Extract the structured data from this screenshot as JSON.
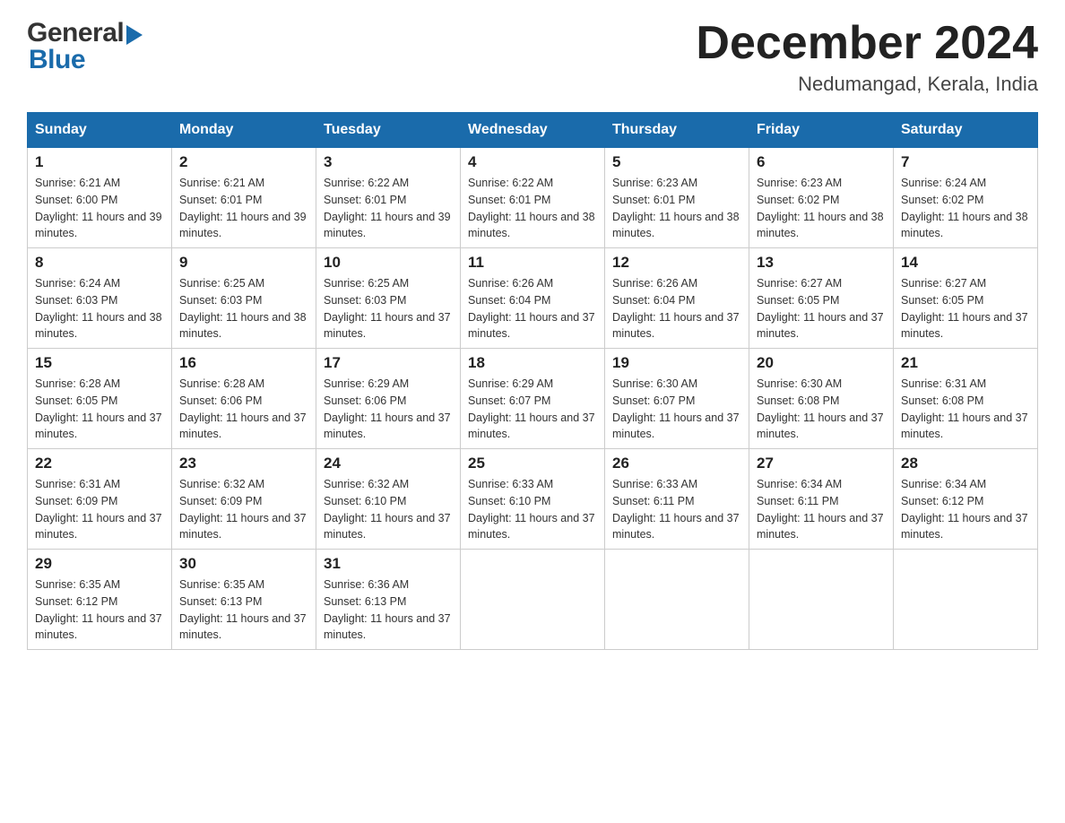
{
  "header": {
    "month_title": "December 2024",
    "location": "Nedumangad, Kerala, India"
  },
  "days_of_week": [
    "Sunday",
    "Monday",
    "Tuesday",
    "Wednesday",
    "Thursday",
    "Friday",
    "Saturday"
  ],
  "weeks": [
    [
      {
        "day": "1",
        "sunrise": "6:21 AM",
        "sunset": "6:00 PM",
        "daylight": "11 hours and 39 minutes."
      },
      {
        "day": "2",
        "sunrise": "6:21 AM",
        "sunset": "6:01 PM",
        "daylight": "11 hours and 39 minutes."
      },
      {
        "day": "3",
        "sunrise": "6:22 AM",
        "sunset": "6:01 PM",
        "daylight": "11 hours and 39 minutes."
      },
      {
        "day": "4",
        "sunrise": "6:22 AM",
        "sunset": "6:01 PM",
        "daylight": "11 hours and 38 minutes."
      },
      {
        "day": "5",
        "sunrise": "6:23 AM",
        "sunset": "6:01 PM",
        "daylight": "11 hours and 38 minutes."
      },
      {
        "day": "6",
        "sunrise": "6:23 AM",
        "sunset": "6:02 PM",
        "daylight": "11 hours and 38 minutes."
      },
      {
        "day": "7",
        "sunrise": "6:24 AM",
        "sunset": "6:02 PM",
        "daylight": "11 hours and 38 minutes."
      }
    ],
    [
      {
        "day": "8",
        "sunrise": "6:24 AM",
        "sunset": "6:03 PM",
        "daylight": "11 hours and 38 minutes."
      },
      {
        "day": "9",
        "sunrise": "6:25 AM",
        "sunset": "6:03 PM",
        "daylight": "11 hours and 38 minutes."
      },
      {
        "day": "10",
        "sunrise": "6:25 AM",
        "sunset": "6:03 PM",
        "daylight": "11 hours and 37 minutes."
      },
      {
        "day": "11",
        "sunrise": "6:26 AM",
        "sunset": "6:04 PM",
        "daylight": "11 hours and 37 minutes."
      },
      {
        "day": "12",
        "sunrise": "6:26 AM",
        "sunset": "6:04 PM",
        "daylight": "11 hours and 37 minutes."
      },
      {
        "day": "13",
        "sunrise": "6:27 AM",
        "sunset": "6:05 PM",
        "daylight": "11 hours and 37 minutes."
      },
      {
        "day": "14",
        "sunrise": "6:27 AM",
        "sunset": "6:05 PM",
        "daylight": "11 hours and 37 minutes."
      }
    ],
    [
      {
        "day": "15",
        "sunrise": "6:28 AM",
        "sunset": "6:05 PM",
        "daylight": "11 hours and 37 minutes."
      },
      {
        "day": "16",
        "sunrise": "6:28 AM",
        "sunset": "6:06 PM",
        "daylight": "11 hours and 37 minutes."
      },
      {
        "day": "17",
        "sunrise": "6:29 AM",
        "sunset": "6:06 PM",
        "daylight": "11 hours and 37 minutes."
      },
      {
        "day": "18",
        "sunrise": "6:29 AM",
        "sunset": "6:07 PM",
        "daylight": "11 hours and 37 minutes."
      },
      {
        "day": "19",
        "sunrise": "6:30 AM",
        "sunset": "6:07 PM",
        "daylight": "11 hours and 37 minutes."
      },
      {
        "day": "20",
        "sunrise": "6:30 AM",
        "sunset": "6:08 PM",
        "daylight": "11 hours and 37 minutes."
      },
      {
        "day": "21",
        "sunrise": "6:31 AM",
        "sunset": "6:08 PM",
        "daylight": "11 hours and 37 minutes."
      }
    ],
    [
      {
        "day": "22",
        "sunrise": "6:31 AM",
        "sunset": "6:09 PM",
        "daylight": "11 hours and 37 minutes."
      },
      {
        "day": "23",
        "sunrise": "6:32 AM",
        "sunset": "6:09 PM",
        "daylight": "11 hours and 37 minutes."
      },
      {
        "day": "24",
        "sunrise": "6:32 AM",
        "sunset": "6:10 PM",
        "daylight": "11 hours and 37 minutes."
      },
      {
        "day": "25",
        "sunrise": "6:33 AM",
        "sunset": "6:10 PM",
        "daylight": "11 hours and 37 minutes."
      },
      {
        "day": "26",
        "sunrise": "6:33 AM",
        "sunset": "6:11 PM",
        "daylight": "11 hours and 37 minutes."
      },
      {
        "day": "27",
        "sunrise": "6:34 AM",
        "sunset": "6:11 PM",
        "daylight": "11 hours and 37 minutes."
      },
      {
        "day": "28",
        "sunrise": "6:34 AM",
        "sunset": "6:12 PM",
        "daylight": "11 hours and 37 minutes."
      }
    ],
    [
      {
        "day": "29",
        "sunrise": "6:35 AM",
        "sunset": "6:12 PM",
        "daylight": "11 hours and 37 minutes."
      },
      {
        "day": "30",
        "sunrise": "6:35 AM",
        "sunset": "6:13 PM",
        "daylight": "11 hours and 37 minutes."
      },
      {
        "day": "31",
        "sunrise": "6:36 AM",
        "sunset": "6:13 PM",
        "daylight": "11 hours and 37 minutes."
      },
      null,
      null,
      null,
      null
    ]
  ]
}
